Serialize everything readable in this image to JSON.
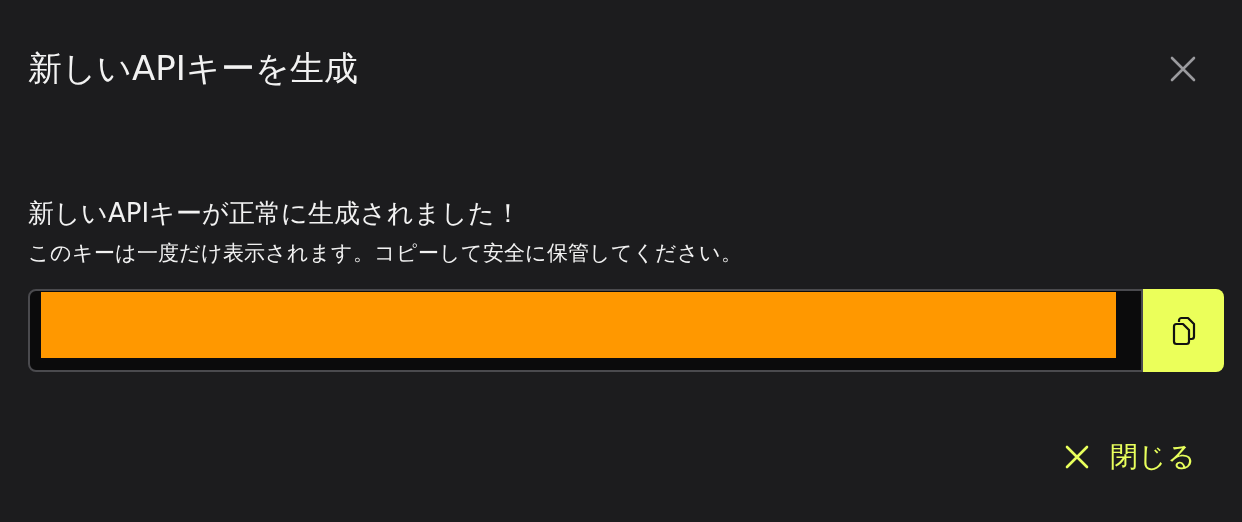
{
  "dialog": {
    "title": "新しいAPIキーを生成"
  },
  "message": {
    "heading": "新しいAPIキーが正常に生成されました！",
    "note": "このキーは一度だけ表示されます。コピーして安全に保管してください。"
  },
  "buttons": [
    {
      "label": "閉じる"
    }
  ]
}
